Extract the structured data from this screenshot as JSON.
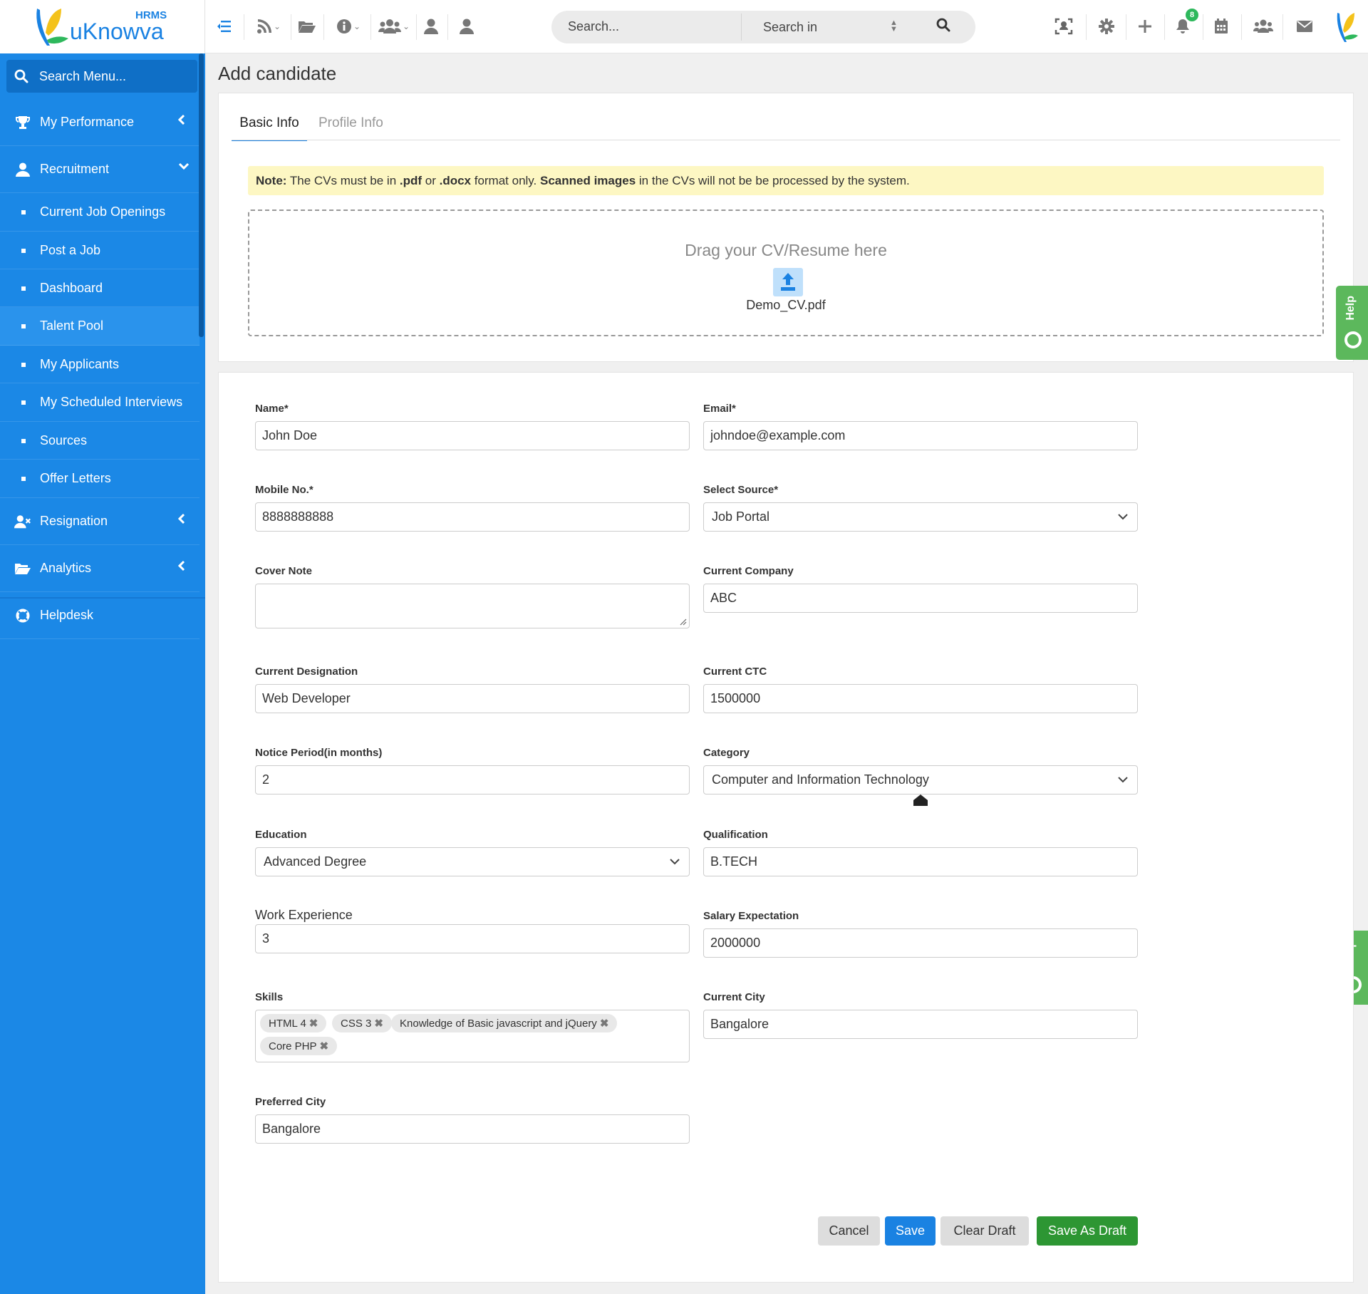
{
  "app": {
    "logo_badge": "HRMS",
    "logo_name": "uKnowva",
    "notification_count": "8"
  },
  "topbar": {
    "search_placeholder": "Search...",
    "search_in_label": "Search in"
  },
  "sidebar": {
    "search_label": "Search Menu...",
    "items": [
      {
        "label": "My Performance",
        "icon": "trophy-icon",
        "chevron": "left"
      },
      {
        "label": "Recruitment",
        "icon": "user-icon",
        "chevron": "down"
      },
      {
        "label": "Current Job Openings"
      },
      {
        "label": "Post a Job"
      },
      {
        "label": "Dashboard"
      },
      {
        "label": "Talent Pool"
      },
      {
        "label": "My Applicants"
      },
      {
        "label": "My Scheduled Interviews"
      },
      {
        "label": "Sources"
      },
      {
        "label": "Offer Letters"
      },
      {
        "label": "Resignation",
        "icon": "user-x-icon",
        "chevron": "left"
      },
      {
        "label": "Analytics",
        "icon": "folder-open-icon",
        "chevron": "left"
      },
      {
        "label": "Helpdesk",
        "icon": "lifebuoy-icon"
      }
    ]
  },
  "page": {
    "title": "Add candidate",
    "tabs": [
      {
        "label": "Basic Info",
        "active": true
      },
      {
        "label": "Profile Info",
        "active": false
      }
    ],
    "note": {
      "prefix": "Note:",
      "text1": " The CVs must be in ",
      "pdf": ".pdf",
      "text2": " or ",
      "docx": ".docx",
      "text3": " format only. ",
      "scanned": "Scanned images",
      "text4": " in the CVs will not be be processed by the system."
    },
    "dropzone": {
      "title": "Drag your CV/Resume here",
      "file_name": "Demo_CV.pdf"
    },
    "help_label": "Help"
  },
  "form": {
    "name": {
      "label": "Name*",
      "value": "John Doe"
    },
    "email": {
      "label": "Email*",
      "value": "johndoe@example.com"
    },
    "mobile": {
      "label": "Mobile No.*",
      "value": "8888888888"
    },
    "source": {
      "label": "Select Source*",
      "value": "Job Portal"
    },
    "cover_note": {
      "label": "Cover Note",
      "value": ""
    },
    "current_company": {
      "label": "Current Company",
      "value": "ABC"
    },
    "current_designation": {
      "label": "Current Designation",
      "value": "Web Developer"
    },
    "current_ctc": {
      "label": "Current CTC",
      "value": "1500000"
    },
    "notice_period": {
      "label": "Notice Period(in months)",
      "value": "2"
    },
    "category": {
      "label": "Category",
      "value": "Computer and Information Technology"
    },
    "education": {
      "label": "Education",
      "value": "Advanced Degree"
    },
    "qualification": {
      "label": "Qualification",
      "value": "B.TECH"
    },
    "work_experience": {
      "label": "Work Experience",
      "value": "3"
    },
    "salary_expectation": {
      "label": "Salary Expectation",
      "value": "2000000"
    },
    "skills": {
      "label": "Skills",
      "tags": [
        "HTML 4",
        "CSS 3",
        "Knowledge of Basic javascript and jQuery",
        "Core PHP"
      ]
    },
    "current_city": {
      "label": "Current City",
      "value": "Bangalore"
    },
    "preferred_city": {
      "label": "Preferred City",
      "value": "Bangalore"
    }
  },
  "actions": {
    "cancel": "Cancel",
    "save": "Save",
    "clear_draft": "Clear Draft",
    "save_as_draft": "Save As Draft"
  },
  "colors": {
    "brand_blue": "#1a82e2",
    "sidebar_blue": "#1b88e6",
    "success_green": "#2d9633",
    "note_yellow": "#fdf7c3"
  }
}
